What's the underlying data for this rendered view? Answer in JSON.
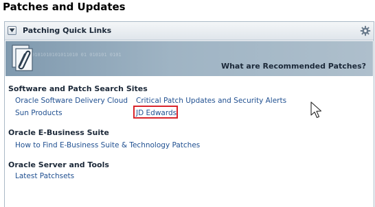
{
  "page": {
    "title": "Patches and Updates"
  },
  "panel": {
    "title": "Patching Quick Links",
    "banner_link": "What are Recommended Patches?",
    "banner_binary": "0101010101011010 01 010101 0101",
    "sections": [
      {
        "heading": "Software and Patch Search Sites",
        "links": [
          "Oracle Software Delivery Cloud",
          "Critical Patch Updates and Security Alerts",
          "Sun Products",
          "JD Edwards"
        ]
      },
      {
        "heading": "Oracle E-Business Suite",
        "links": [
          "How to Find E-Business Suite & Technology Patches"
        ]
      },
      {
        "heading": "Oracle Server and Tools",
        "links": [
          "Latest Patchsets"
        ]
      }
    ]
  },
  "icons": {
    "collapse": "triangle-down-icon",
    "settings": "gear-icon",
    "banner": "paperclip-document-icon",
    "cursor": "mouse-pointer-icon"
  },
  "colors": {
    "link": "#1f4f90",
    "highlight": "#d8232a",
    "banner": "#9fb4c4"
  }
}
